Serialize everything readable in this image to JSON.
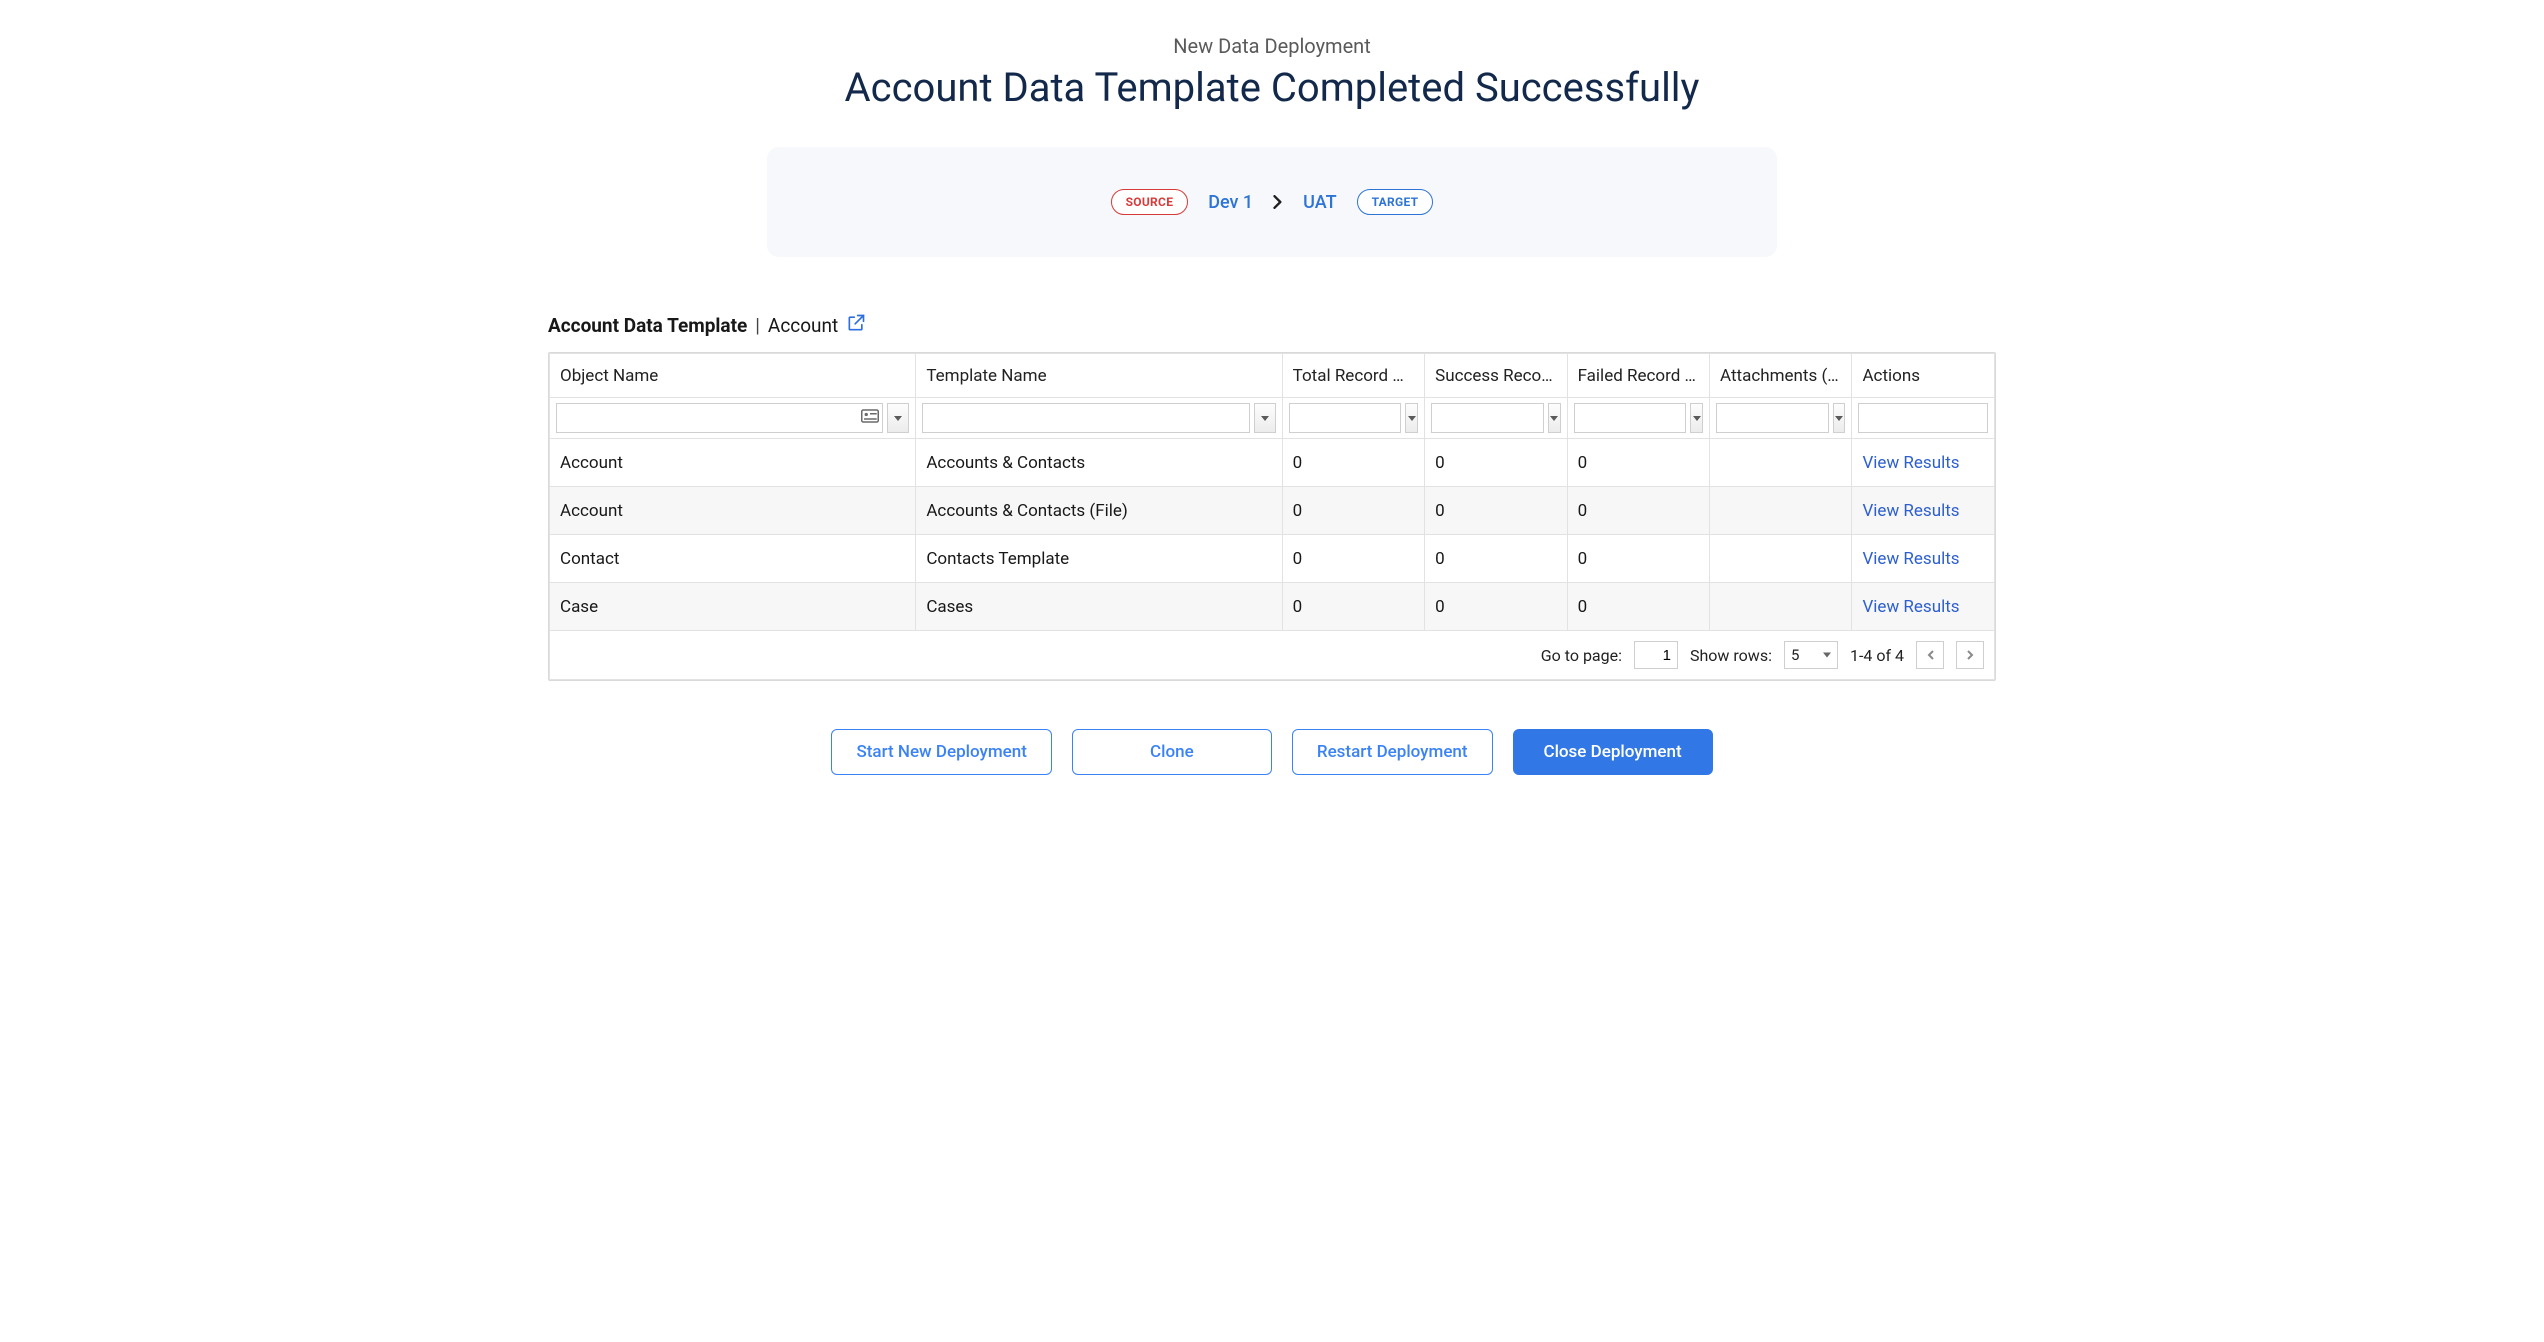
{
  "header": {
    "subtitle": "New Data Deployment",
    "title": "Account Data Template Completed Successfully"
  },
  "env": {
    "source_pill": "SOURCE",
    "source_name": "Dev 1",
    "target_pill": "TARGET",
    "target_name": "UAT"
  },
  "template_bar": {
    "name": "Account Data Template",
    "separator": "|",
    "object": "Account"
  },
  "columns": {
    "c0": "Object Name",
    "c1": "Template Name",
    "c2": "Total Record C…",
    "c3": "Success Record…",
    "c4": "Failed Record C…",
    "c5": "Attachments (…",
    "c6": "Actions"
  },
  "rows": [
    {
      "object": "Account",
      "template": "Accounts & Contacts",
      "total": "0",
      "success": "0",
      "failed": "0",
      "attachments": "",
      "action": "View Results"
    },
    {
      "object": "Account",
      "template": "Accounts & Contacts (File)",
      "total": "0",
      "success": "0",
      "failed": "0",
      "attachments": "",
      "action": "View Results"
    },
    {
      "object": "Contact",
      "template": "Contacts Template",
      "total": "0",
      "success": "0",
      "failed": "0",
      "attachments": "",
      "action": "View Results"
    },
    {
      "object": "Case",
      "template": "Cases",
      "total": "0",
      "success": "0",
      "failed": "0",
      "attachments": "",
      "action": "View Results"
    }
  ],
  "pager": {
    "go_label": "Go to page:",
    "go_value": "1",
    "rows_label": "Show rows:",
    "rows_value": "5",
    "range": "1-4 of 4"
  },
  "footer": {
    "start": "Start New Deployment",
    "clone": "Clone",
    "restart": "Restart Deployment",
    "close": "Close Deployment"
  }
}
